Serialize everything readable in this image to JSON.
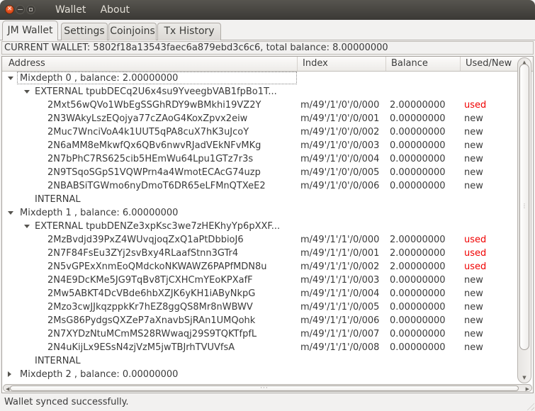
{
  "titlebar": {
    "menu": [
      {
        "label": "Wallet"
      },
      {
        "label": "About"
      }
    ],
    "close_glyph": "✕"
  },
  "tabs": [
    {
      "label": "JM Wallet",
      "active": true
    },
    {
      "label": "Settings",
      "active": false
    },
    {
      "label": "Coinjoins",
      "active": false
    },
    {
      "label": "Tx History",
      "active": false
    }
  ],
  "banner": "CURRENT WALLET: 5802f18a13543faec6a879ebd3c6c6, total balance: 8.00000000",
  "table": {
    "headers": {
      "address": "Address",
      "index": "Index",
      "balance": "Balance",
      "used_new": "Used/New"
    }
  },
  "colors": {
    "used_red": "#f00000",
    "close_button_orange": "#e04a18"
  },
  "mixdepths": [
    {
      "label": "Mixdepth 0 , balance: 2.00000000",
      "expanded": true,
      "focused": true,
      "branches": [
        {
          "name": "EXTERNAL",
          "xpub": "tpubDECq2U6x4su9YveegbVAB1fpBo1T...",
          "expanded": true,
          "entries": [
            {
              "address": "2Mxt56wQVo1WbEgSSGhRDY9wBMkhi19VZ2Y",
              "index": "m/49'/1'/0'/0/000",
              "balance": "2.00000000",
              "status": "used"
            },
            {
              "address": "2N3WAkyLszEQojya77cZAoG4KoxZpvx2eiw",
              "index": "m/49'/1'/0'/0/001",
              "balance": "0.00000000",
              "status": "new"
            },
            {
              "address": "2Muc7WnciVoA4k1UUT5qPA8cuX7hK3uJcoY",
              "index": "m/49'/1'/0'/0/002",
              "balance": "0.00000000",
              "status": "new"
            },
            {
              "address": "2N6aMM8eMkwfQx6QBv6nwvRJadVEkNFvMKg",
              "index": "m/49'/1'/0'/0/003",
              "balance": "0.00000000",
              "status": "new"
            },
            {
              "address": "2N7bPhC7RS625cib5HEmWu64Lpu1GTz7r3s",
              "index": "m/49'/1'/0'/0/004",
              "balance": "0.00000000",
              "status": "new"
            },
            {
              "address": "2N9TSqoSGpS1VQWPrn4a4WmotECAcG74uzp",
              "index": "m/49'/1'/0'/0/005",
              "balance": "0.00000000",
              "status": "new"
            },
            {
              "address": "2NBABSiTGWmo6nyDmoT6DR65eLFMnQTXeE2",
              "index": "m/49'/1'/0'/0/006",
              "balance": "0.00000000",
              "status": "new"
            }
          ]
        },
        {
          "name": "INTERNAL",
          "entries": []
        }
      ]
    },
    {
      "label": "Mixdepth 1 , balance: 6.00000000",
      "expanded": true,
      "focused": false,
      "branches": [
        {
          "name": "EXTERNAL",
          "xpub": "tpubDENZe3xpKsc3we7zHEKhyYp6pXXF...",
          "expanded": true,
          "entries": [
            {
              "address": "2MzBvdjd39PxZ4WUvqjoqZxQ1aPtDbbioJ6",
              "index": "m/49'/1'/1'/0/000",
              "balance": "2.00000000",
              "status": "used"
            },
            {
              "address": "2N7F84FsEu3ZYj2svBxy4RLaafStnn3GTr4",
              "index": "m/49'/1'/1'/0/001",
              "balance": "2.00000000",
              "status": "used"
            },
            {
              "address": "2N5vGPExXnmEoQMdckoNKWAWZ6PAPfMDN8u",
              "index": "m/49'/1'/1'/0/002",
              "balance": "2.00000000",
              "status": "used"
            },
            {
              "address": "2N4E9DcKMe5JG9TqBv8TjCXHCmYEoKPXafF",
              "index": "m/49'/1'/1'/0/003",
              "balance": "0.00000000",
              "status": "new"
            },
            {
              "address": "2Mw5ABKT4DcVBde6hbXZJK6yKH1iAByNkpG",
              "index": "m/49'/1'/1'/0/004",
              "balance": "0.00000000",
              "status": "new"
            },
            {
              "address": "2Mzo3cwJJkqzppkKr7hEZ8ggQS8Mr8nWBWV",
              "index": "m/49'/1'/1'/0/005",
              "balance": "0.00000000",
              "status": "new"
            },
            {
              "address": "2MsG86PydgsQXZeP7aXnavbSjRAn1UMQohk",
              "index": "m/49'/1'/1'/0/006",
              "balance": "0.00000000",
              "status": "new"
            },
            {
              "address": "2N7XYDzNtuMCmMS28RWwaqj29S9TQKTfpfL",
              "index": "m/49'/1'/1'/0/007",
              "balance": "0.00000000",
              "status": "new"
            },
            {
              "address": "2N4uKijLx9ESsN4zjVzM5jwTBJrhTVUVfsA",
              "index": "m/49'/1'/1'/0/008",
              "balance": "0.00000000",
              "status": "new"
            }
          ]
        },
        {
          "name": "INTERNAL",
          "entries": []
        }
      ]
    },
    {
      "label": "Mixdepth 2 , balance: 0.00000000",
      "expanded": false,
      "focused": false,
      "branches": []
    }
  ],
  "statusbar": {
    "message": "Wallet synced successfully."
  }
}
